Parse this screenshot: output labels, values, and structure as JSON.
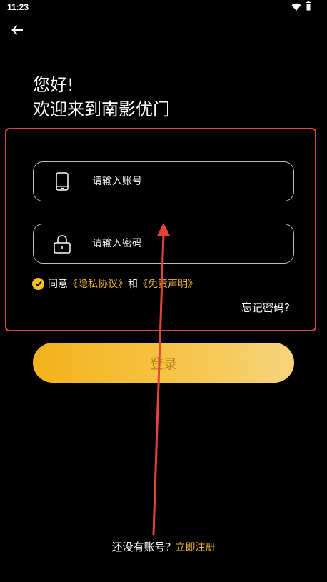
{
  "status_bar": {
    "time": "11:23",
    "icons": [
      "wifi-icon",
      "battery-icon"
    ]
  },
  "header": {
    "back_icon": "arrow-left-icon"
  },
  "greeting": {
    "line1": "您好!",
    "line2": "欢迎来到南影优门"
  },
  "form": {
    "account_placeholder": "请输入账号",
    "account_value": "",
    "account_icon": "phone-icon",
    "password_placeholder": "请输入密码",
    "password_value": "",
    "password_icon": "lock-icon",
    "agree": {
      "prefix": "同意",
      "privacy_link": "《隐私协议》",
      "and": "和",
      "disclaimer_link": "《免责声明》",
      "checked": true
    },
    "forgot_password": "忘记密码?",
    "login_label": "登录"
  },
  "footer": {
    "no_account": "还没有账号?",
    "register_link": "立即注册"
  },
  "colors": {
    "accent_gold": "#f0b230",
    "annotation_red": "#e4453a",
    "background": "#000000"
  }
}
